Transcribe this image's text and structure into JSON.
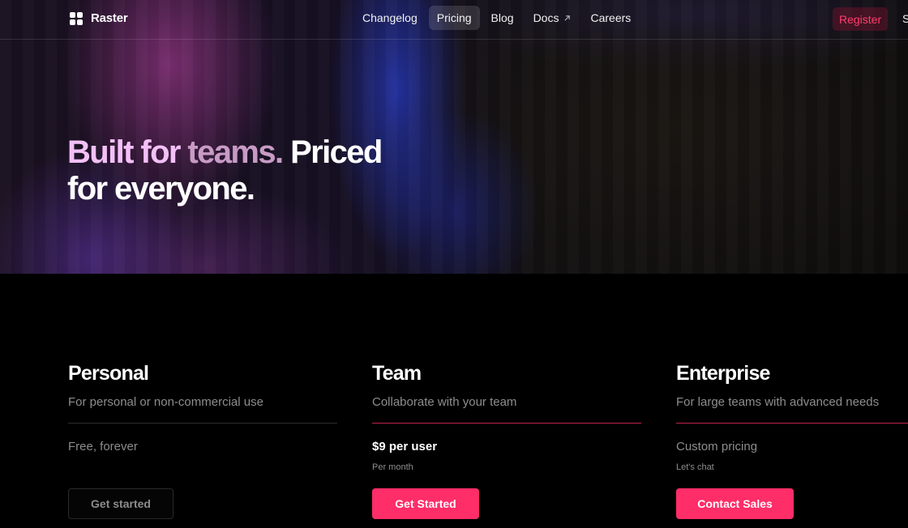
{
  "brand": {
    "name": "Raster"
  },
  "nav": {
    "links": [
      {
        "label": "Changelog",
        "active": false
      },
      {
        "label": "Pricing",
        "active": true
      },
      {
        "label": "Blog",
        "active": false
      },
      {
        "label": "Docs",
        "active": false,
        "external": true
      },
      {
        "label": "Careers",
        "active": false
      }
    ],
    "register": "Register",
    "signin_partial": "S"
  },
  "hero": {
    "part1": "Built for ",
    "part2": "teams.",
    "part3": " Priced",
    "line2": "for everyone."
  },
  "plans": [
    {
      "name": "Personal",
      "description": "For personal or non-commercial use",
      "price": "Free, forever",
      "price_sub": "",
      "button": "Get started"
    },
    {
      "name": "Team",
      "description": "Collaborate with your team",
      "price": "$9 per user",
      "price_sub": "Per month",
      "button": "Get Started"
    },
    {
      "name": "Enterprise",
      "description": "For large teams with advanced needs",
      "price": "Custom pricing",
      "price_sub": "Let's chat",
      "button": "Contact Sales"
    }
  ],
  "colors": {
    "accent": "#ff2d68",
    "background": "#000000",
    "muted_text": "#8d8d8d",
    "gradient_text_start": "#f3c0f7",
    "gradient_text_end": "#c79bc6"
  }
}
